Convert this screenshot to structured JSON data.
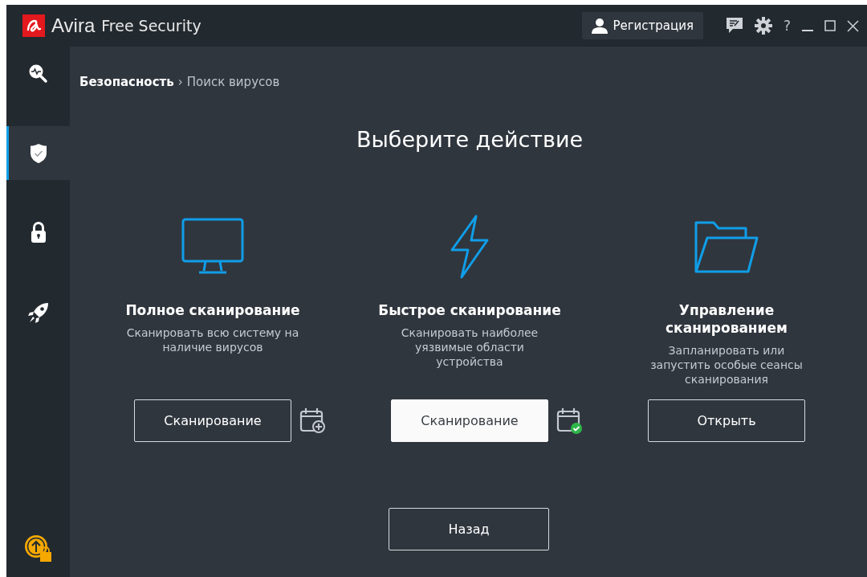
{
  "window": {
    "brand": "Avira",
    "product": "Free Security",
    "register_button": "Регистрация",
    "help": "?"
  },
  "sidebar": {
    "items": [
      {
        "kind": "scan",
        "selected": false
      },
      {
        "kind": "shield",
        "selected": true
      },
      {
        "kind": "lock",
        "selected": false
      },
      {
        "kind": "rocket",
        "selected": false
      }
    ]
  },
  "breadcrumb": {
    "items": [
      "Безопасность",
      "Поиск вирусов"
    ],
    "separator": "›"
  },
  "heading": "Выберите действие",
  "actions": [
    {
      "kind": "monitor",
      "title": "Полное сканирование",
      "description": "Сканировать всю систему на наличие вирусов",
      "button": {
        "label": "Сканирование",
        "primary": false
      },
      "schedule_icon": true,
      "scheduled": false
    },
    {
      "kind": "bolt",
      "title": "Быстрое сканирование",
      "description": "Сканировать наиболее уязвимые области устройства",
      "button": {
        "label": "Сканирование",
        "primary": true
      },
      "schedule_icon": true,
      "scheduled": true
    },
    {
      "kind": "folder",
      "title": "Управление сканированием",
      "description": "Запланировать или запустить особые сеансы сканирования",
      "button": {
        "label": "Открыть",
        "primary": false
      },
      "schedule_icon": false
    }
  ],
  "back_button": "Назад"
}
